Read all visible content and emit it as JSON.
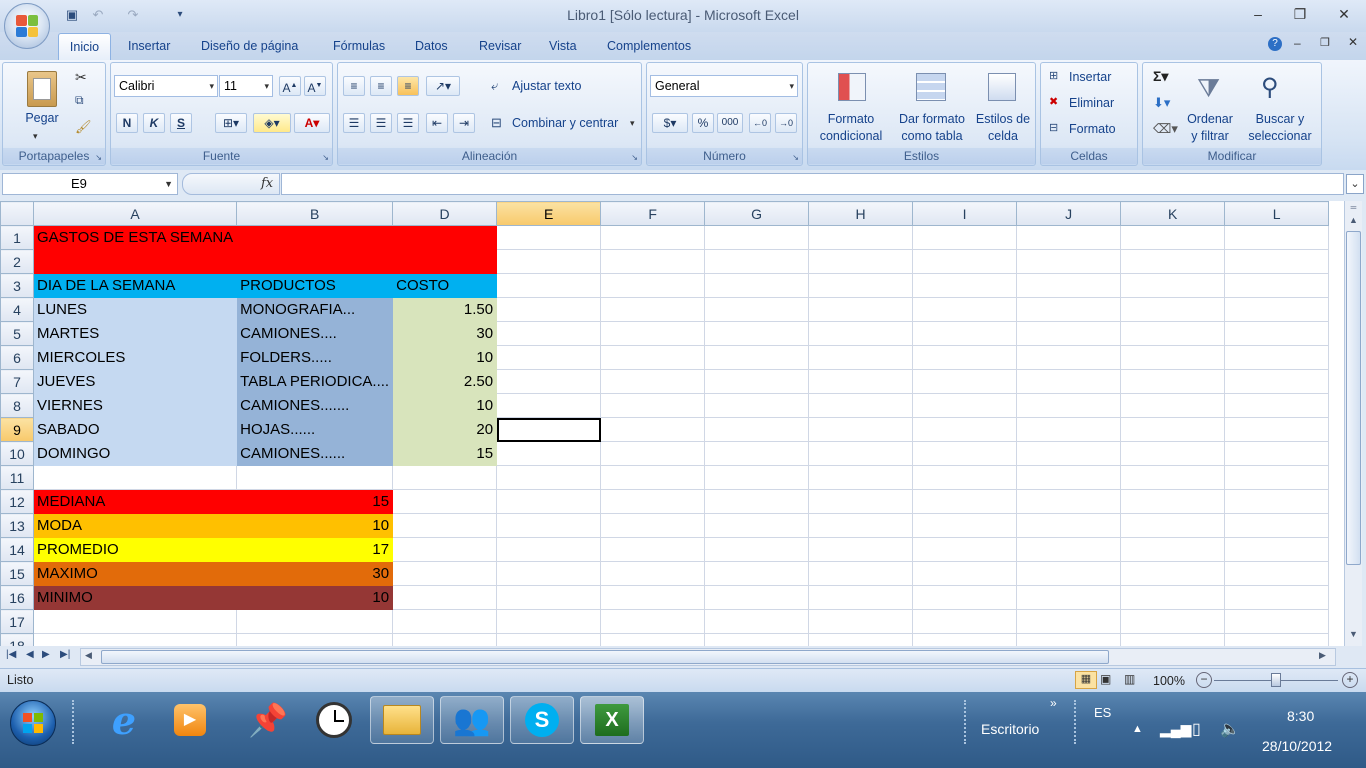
{
  "window": {
    "title": "Libro1  [Sólo lectura] - Microsoft Excel"
  },
  "tabs": [
    "Inicio",
    "Insertar",
    "Diseño de página",
    "Fórmulas",
    "Datos",
    "Revisar",
    "Vista",
    "Complementos"
  ],
  "ribbon": {
    "portapapeles": {
      "label": "Portapapeles",
      "pegar": "Pegar"
    },
    "fuente": {
      "label": "Fuente",
      "font": "Calibri",
      "size": "11",
      "bold": "N",
      "italic": "K",
      "underline": "S"
    },
    "alineacion": {
      "label": "Alineación",
      "wrap": "Ajustar texto",
      "merge": "Combinar y centrar"
    },
    "numero": {
      "label": "Número",
      "format": "General",
      "percent": "%",
      "thousands": "000"
    },
    "estilos": {
      "label": "Estilos",
      "cond1": "Formato",
      "cond2": "condicional",
      "table1": "Dar formato",
      "table2": "como tabla",
      "cell1": "Estilos de",
      "cell2": "celda"
    },
    "celdas": {
      "label": "Celdas",
      "insert": "Insertar",
      "delete": "Eliminar",
      "format": "Formato"
    },
    "modificar": {
      "label": "Modificar",
      "sort1": "Ordenar",
      "sort2": "y filtrar",
      "find1": "Buscar y",
      "find2": "seleccionar"
    }
  },
  "namebox": "E9",
  "fx": "fx",
  "columns": [
    "A",
    "B",
    "D",
    "E",
    "F",
    "G",
    "H",
    "I",
    "J",
    "K",
    "L"
  ],
  "rows": [
    {
      "n": "1",
      "a": "GASTOS DE ESTA SEMANA",
      "b": "",
      "d": ""
    },
    {
      "n": "2",
      "a": "",
      "b": "",
      "d": ""
    },
    {
      "n": "3",
      "a": "DIA DE LA SEMANA",
      "b": "PRODUCTOS",
      "d": "COSTO"
    },
    {
      "n": "4",
      "a": "LUNES",
      "b": "MONOGRAFIA...",
      "d": "1.50"
    },
    {
      "n": "5",
      "a": "MARTES",
      "b": "CAMIONES....",
      "d": "30"
    },
    {
      "n": "6",
      "a": "MIERCOLES",
      "b": "FOLDERS.....",
      "d": "10"
    },
    {
      "n": "7",
      "a": "JUEVES",
      "b": "TABLA PERIODICA....",
      "d": "2.50"
    },
    {
      "n": "8",
      "a": "VIERNES",
      "b": "CAMIONES.......",
      "d": "10"
    },
    {
      "n": "9",
      "a": "SABADO",
      "b": "HOJAS......",
      "d": "20"
    },
    {
      "n": "10",
      "a": "DOMINGO",
      "b": "CAMIONES......",
      "d": "15"
    },
    {
      "n": "11",
      "a": "",
      "b": "",
      "d": ""
    },
    {
      "n": "12",
      "a": "MEDIANA",
      "b": "15",
      "d": ""
    },
    {
      "n": "13",
      "a": "MODA",
      "b": "10",
      "d": ""
    },
    {
      "n": "14",
      "a": "PROMEDIO",
      "b": "17",
      "d": ""
    },
    {
      "n": "15",
      "a": "MAXIMO",
      "b": "30",
      "d": ""
    },
    {
      "n": "16",
      "a": "MINIMO",
      "b": "10",
      "d": ""
    },
    {
      "n": "17",
      "a": "",
      "b": "",
      "d": ""
    },
    {
      "n": "18",
      "a": "",
      "b": "",
      "d": ""
    }
  ],
  "colors": {
    "red": "#ff0000",
    "cyan": "#00b0f0",
    "lightblue": "#c5d9f1",
    "blue": "#95b3d7",
    "green": "#d8e4bc",
    "orange": "#ffc000",
    "yellow": "#ffff00",
    "darkorange": "#e26b0a",
    "brown": "#953735"
  },
  "status": {
    "ready": "Listo",
    "zoom": "100%"
  },
  "taskbar": {
    "desktop": "Escritorio",
    "lang": "ES",
    "time": "8:30",
    "date": "28/10/2012"
  }
}
